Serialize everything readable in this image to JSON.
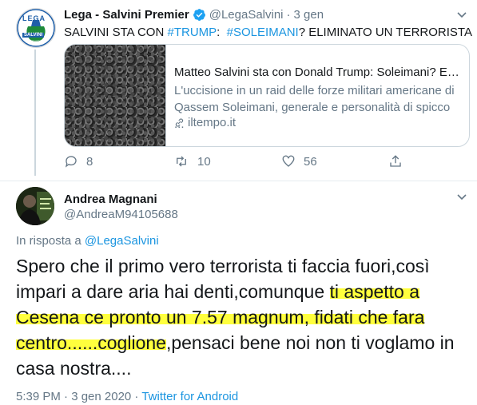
{
  "tweet1": {
    "author_name": "Lega - Salvini Premier",
    "handle": "@LegaSalvini",
    "separator": "·",
    "time": "3 gen",
    "text_parts": [
      "SALVINI STA CON ",
      "#TRUMP",
      ":  ",
      "#SOLEIMANI",
      "? ELIMINATO UN TERRORISTA"
    ],
    "avatar_text": [
      "LEGA",
      "SALVINI",
      "PREMIER"
    ],
    "card": {
      "title": "Matteo Salvini sta con Donald Trump: Soleimani? Eli...",
      "description": "L'uccisione in un raid delle forze militari americane di Qassem Soleimani, generale e personalità di spicco ...",
      "domain": "iltempo.it"
    },
    "actions": {
      "replies": "8",
      "retweets": "10",
      "likes": "56"
    }
  },
  "tweet2": {
    "author_name": "Andrea Magnani",
    "handle": "@AndreaM94105688",
    "reply_prefix": "In risposta a ",
    "reply_to": "@LegaSalvini",
    "text_lines": [
      [
        "Spero che il primo vero terrorista ti faccia fuori,così"
      ],
      [
        "impari a dare aria hai denti,comunque",
        "ti aspetto a"
      ],
      [
        "Cesena ce pronto un 7.57 magnum, fidati che fara"
      ],
      [
        "centro......coglione",
        ",pensaci bene noi non ti voglamo in"
      ],
      [
        "casa nostra...."
      ]
    ],
    "timestamp": "5:39 PM · 3 gen 2020 · ",
    "source": "Twitter for Android"
  },
  "colors": {
    "accent": "#1b95e0",
    "muted": "#657786",
    "highlight": "#ffff3d",
    "lega_green": "#1e8a3a",
    "lega_blue": "#1f5fa8"
  }
}
